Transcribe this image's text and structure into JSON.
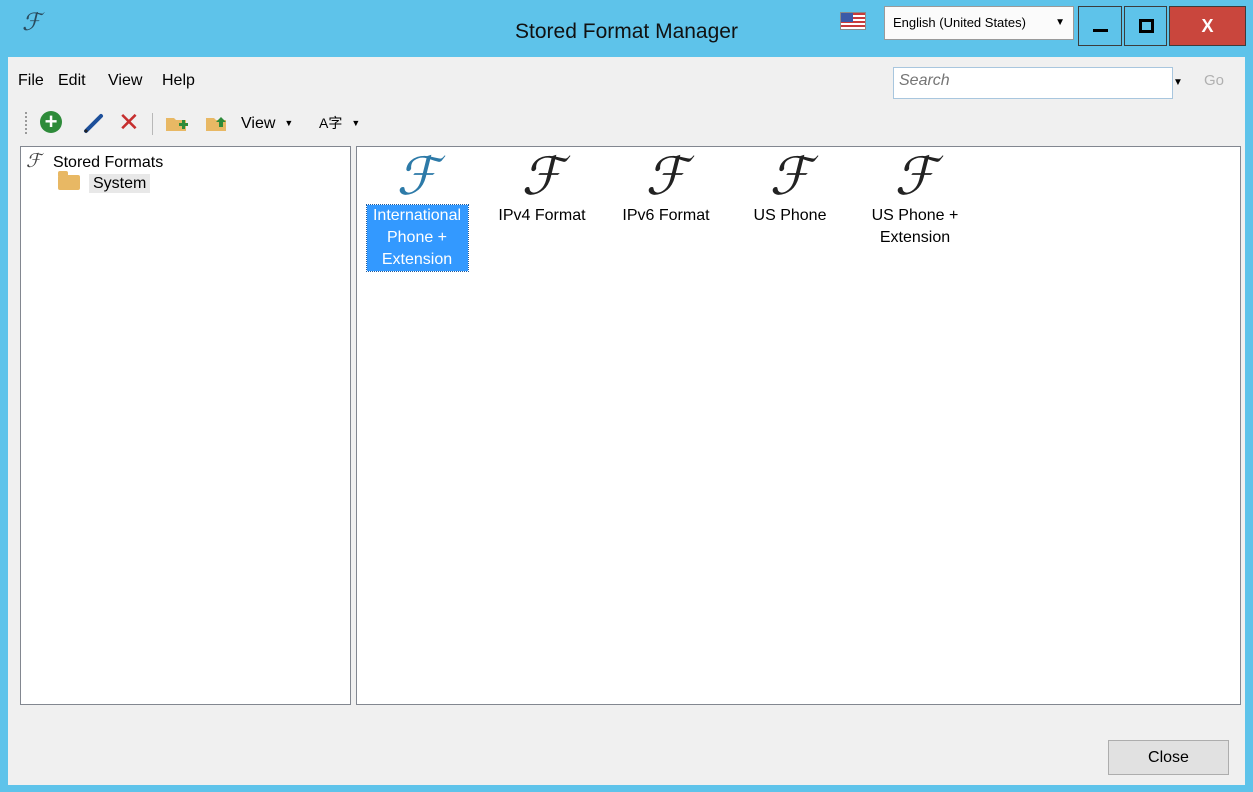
{
  "window": {
    "title": "Stored Format Manager",
    "app_icon": "format-script-F",
    "language": "English (United States)",
    "close_glyph": "X"
  },
  "menu": {
    "items": [
      "File",
      "Edit",
      "View",
      "Help"
    ]
  },
  "search": {
    "placeholder": "Search",
    "go_label": "Go"
  },
  "toolbar": {
    "view_label": "View",
    "language_glyph": "A字"
  },
  "tree": {
    "root_label": "Stored Formats",
    "child_label": "System"
  },
  "formats": {
    "items": [
      {
        "label": "International Phone + Extension",
        "selected": true
      },
      {
        "label": "IPv4 Format",
        "selected": false
      },
      {
        "label": "IPv6 Format",
        "selected": false
      },
      {
        "label": "US Phone",
        "selected": false
      },
      {
        "label": "US Phone + Extension",
        "selected": false
      }
    ]
  },
  "footer": {
    "close_label": "Close"
  },
  "colors": {
    "titlebar": "#5ec3ea",
    "close_button": "#c9463d",
    "selection": "#3399ff"
  }
}
